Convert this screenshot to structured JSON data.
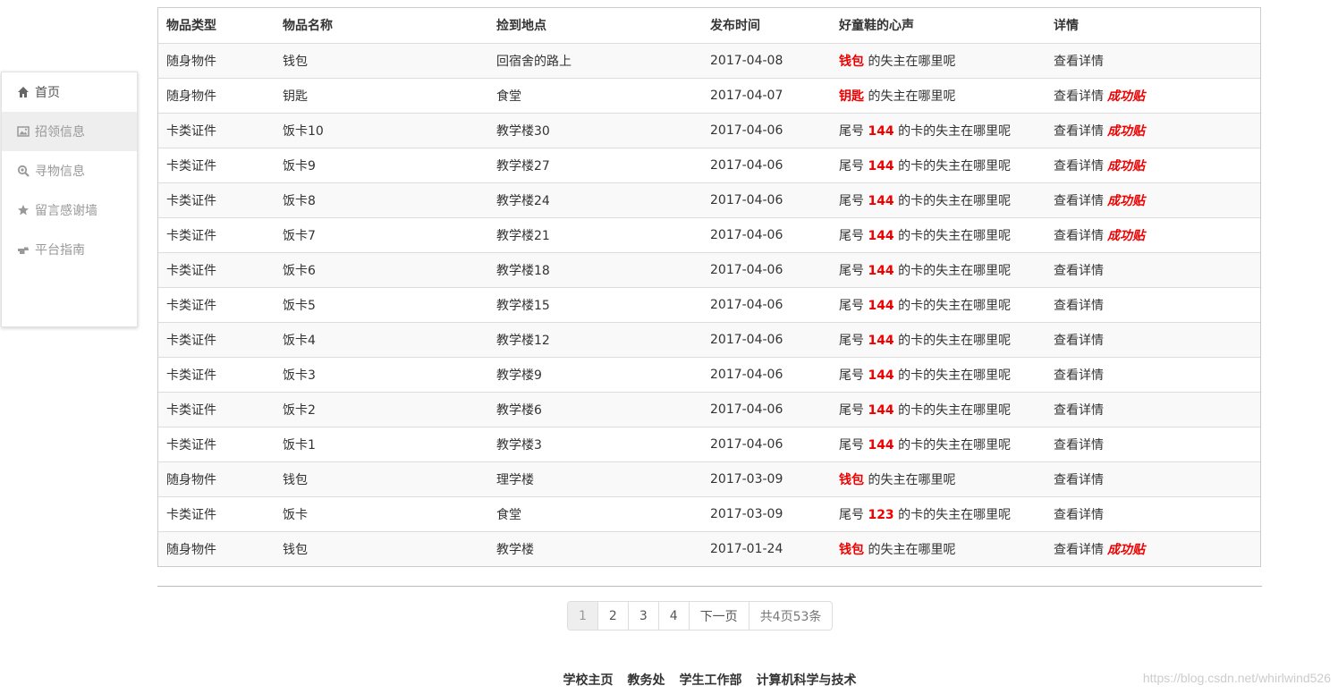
{
  "sidebar": {
    "items": [
      {
        "label": "首页",
        "icon": "home-icon"
      },
      {
        "label": "招领信息",
        "icon": "picture-icon"
      },
      {
        "label": "寻物信息",
        "icon": "zoom-icon"
      },
      {
        "label": "留言感谢墙",
        "icon": "star-icon"
      },
      {
        "label": "平台指南",
        "icon": "hand-pointing-icon"
      }
    ]
  },
  "table": {
    "headers": [
      "物品类型",
      "物品名称",
      "捡到地点",
      "发布时间",
      "好童鞋的心声",
      "详情"
    ],
    "rows": [
      {
        "type": "随身物件",
        "name": "钱包",
        "place": "回宿舍的路上",
        "date": "2017-04-08",
        "voice_pre": "",
        "voice_hl": "钱包",
        "voice_post": " 的失主在哪里呢",
        "detail": "查看详情",
        "success": ""
      },
      {
        "type": "随身物件",
        "name": "钥匙",
        "place": "食堂",
        "date": "2017-04-07",
        "voice_pre": "",
        "voice_hl": "钥匙",
        "voice_post": " 的失主在哪里呢",
        "detail": "查看详情",
        "success": "成功贴"
      },
      {
        "type": "卡类证件",
        "name": "饭卡10",
        "place": "教学楼30",
        "date": "2017-04-06",
        "voice_pre": "尾号 ",
        "voice_hl": "144",
        "voice_post": " 的卡的失主在哪里呢",
        "detail": "查看详情",
        "success": "成功贴"
      },
      {
        "type": "卡类证件",
        "name": "饭卡9",
        "place": "教学楼27",
        "date": "2017-04-06",
        "voice_pre": "尾号 ",
        "voice_hl": "144",
        "voice_post": " 的卡的失主在哪里呢",
        "detail": "查看详情",
        "success": "成功贴"
      },
      {
        "type": "卡类证件",
        "name": "饭卡8",
        "place": "教学楼24",
        "date": "2017-04-06",
        "voice_pre": "尾号 ",
        "voice_hl": "144",
        "voice_post": " 的卡的失主在哪里呢",
        "detail": "查看详情",
        "success": "成功贴"
      },
      {
        "type": "卡类证件",
        "name": "饭卡7",
        "place": "教学楼21",
        "date": "2017-04-06",
        "voice_pre": "尾号 ",
        "voice_hl": "144",
        "voice_post": " 的卡的失主在哪里呢",
        "detail": "查看详情",
        "success": "成功贴"
      },
      {
        "type": "卡类证件",
        "name": "饭卡6",
        "place": "教学楼18",
        "date": "2017-04-06",
        "voice_pre": "尾号 ",
        "voice_hl": "144",
        "voice_post": " 的卡的失主在哪里呢",
        "detail": "查看详情",
        "success": ""
      },
      {
        "type": "卡类证件",
        "name": "饭卡5",
        "place": "教学楼15",
        "date": "2017-04-06",
        "voice_pre": "尾号 ",
        "voice_hl": "144",
        "voice_post": " 的卡的失主在哪里呢",
        "detail": "查看详情",
        "success": ""
      },
      {
        "type": "卡类证件",
        "name": "饭卡4",
        "place": "教学楼12",
        "date": "2017-04-06",
        "voice_pre": "尾号 ",
        "voice_hl": "144",
        "voice_post": " 的卡的失主在哪里呢",
        "detail": "查看详情",
        "success": ""
      },
      {
        "type": "卡类证件",
        "name": "饭卡3",
        "place": "教学楼9",
        "date": "2017-04-06",
        "voice_pre": "尾号 ",
        "voice_hl": "144",
        "voice_post": " 的卡的失主在哪里呢",
        "detail": "查看详情",
        "success": ""
      },
      {
        "type": "卡类证件",
        "name": "饭卡2",
        "place": "教学楼6",
        "date": "2017-04-06",
        "voice_pre": "尾号 ",
        "voice_hl": "144",
        "voice_post": " 的卡的失主在哪里呢",
        "detail": "查看详情",
        "success": ""
      },
      {
        "type": "卡类证件",
        "name": "饭卡1",
        "place": "教学楼3",
        "date": "2017-04-06",
        "voice_pre": "尾号 ",
        "voice_hl": "144",
        "voice_post": " 的卡的失主在哪里呢",
        "detail": "查看详情",
        "success": ""
      },
      {
        "type": "随身物件",
        "name": "钱包",
        "place": "理学楼",
        "date": "2017-03-09",
        "voice_pre": "",
        "voice_hl": "钱包",
        "voice_post": " 的失主在哪里呢",
        "detail": "查看详情",
        "success": ""
      },
      {
        "type": "卡类证件",
        "name": "饭卡",
        "place": "食堂",
        "date": "2017-03-09",
        "voice_pre": "尾号 ",
        "voice_hl": "123",
        "voice_post": " 的卡的失主在哪里呢",
        "detail": "查看详情",
        "success": ""
      },
      {
        "type": "随身物件",
        "name": "钱包",
        "place": "教学楼",
        "date": "2017-01-24",
        "voice_pre": "",
        "voice_hl": "钱包",
        "voice_post": " 的失主在哪里呢",
        "detail": "查看详情",
        "success": "成功贴"
      }
    ]
  },
  "pagination": {
    "pages": [
      "1",
      "2",
      "3",
      "4"
    ],
    "active": "1",
    "next_label": "下一页",
    "summary": "共4页53条"
  },
  "footer": {
    "links": [
      "学校主页",
      "教务处",
      "学生工作部",
      "计算机科学与技术"
    ],
    "watermark": "https://blog.csdn.net/whirlwind526"
  },
  "colors": {
    "highlight": "#ee0000",
    "active_bg": "#eeeeee",
    "stripe_bg": "#f9f9f9"
  }
}
